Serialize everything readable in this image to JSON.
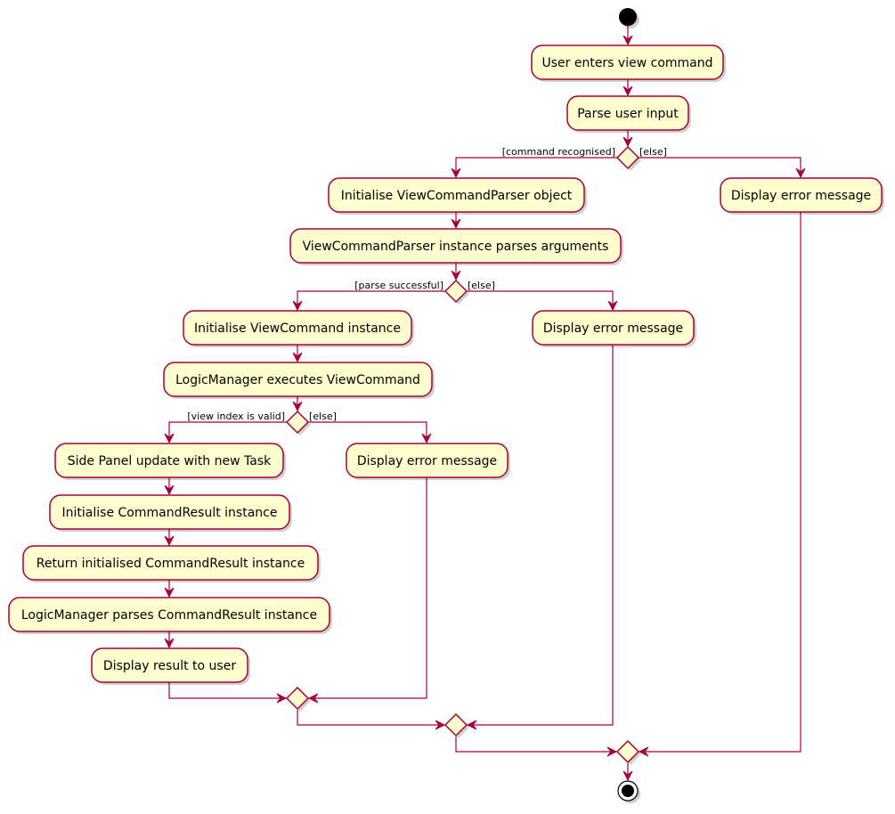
{
  "diagram": {
    "type": "UML activity diagram",
    "colors": {
      "activity_fill": "#FEFECE",
      "border": "#A80036",
      "start_fill": "#000000"
    },
    "activities": {
      "user_enters": "User enters view command",
      "parse_input": "Parse user input",
      "init_parser": "Initialise ViewCommandParser object",
      "parser_parses": "ViewCommandParser instance parses arguments",
      "error_1": "Display error message",
      "init_command": "Initialise ViewCommand instance",
      "error_2": "Display error message",
      "logic_executes": "LogicManager executes ViewCommand",
      "side_panel": "Side Panel update with new Task",
      "error_3": "Display error message",
      "init_result": "Initialise CommandResult instance",
      "return_result": "Return initialised CommandResult instance",
      "logic_parses": "LogicManager parses CommandResult instance",
      "display_result": "Display result to user"
    },
    "guards": {
      "d1_yes": "[command recognised]",
      "d1_no": "[else]",
      "d2_yes": "[parse successful]",
      "d2_no": "[else]",
      "d3_yes": "[view index is valid]",
      "d3_no": "[else]"
    },
    "nodes": {
      "start": "start-node",
      "end": "end-node"
    }
  }
}
